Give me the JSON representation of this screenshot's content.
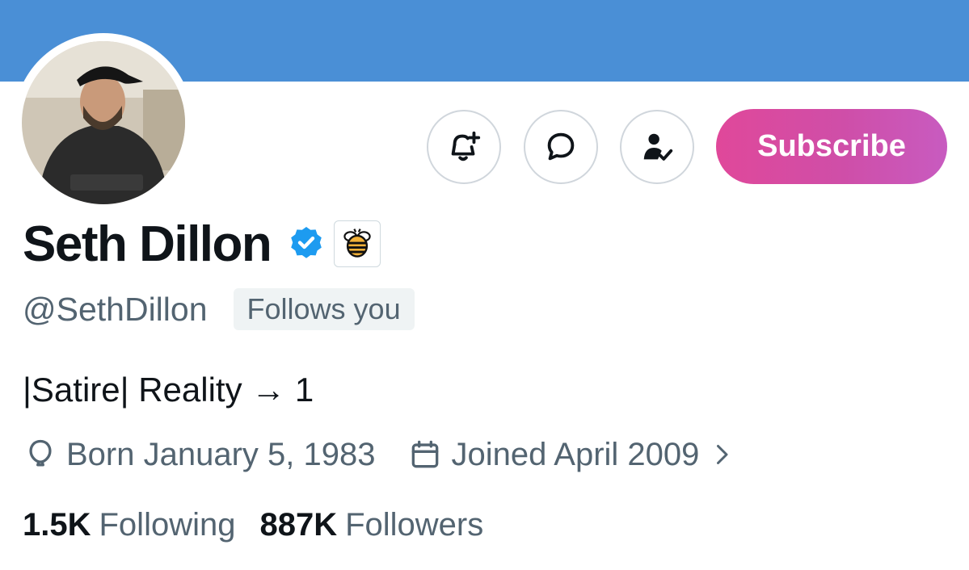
{
  "profile": {
    "name": "Seth Dillon",
    "handle": "@SethDillon",
    "follows_badge": "Follows you",
    "bio": "|Satire| Reality → 1",
    "born": "Born January 5, 1983",
    "joined": "Joined April 2009",
    "avatar": "profile-photo"
  },
  "actions": {
    "notify_icon": "bell-plus-icon",
    "message_icon": "message-bubble-icon",
    "following_icon": "person-check-icon",
    "subscribe_label": "Subscribe"
  },
  "stats": {
    "following_count": "1.5K",
    "following_label": "Following",
    "followers_count": "887K",
    "followers_label": "Followers"
  },
  "colors": {
    "banner": "#4a8fd6",
    "verified": "#1d9bf0",
    "subscribe_gradient_start": "#e0489a",
    "subscribe_gradient_end": "#c85bc0",
    "secondary_text": "#536471",
    "primary_text": "#0f1419"
  }
}
